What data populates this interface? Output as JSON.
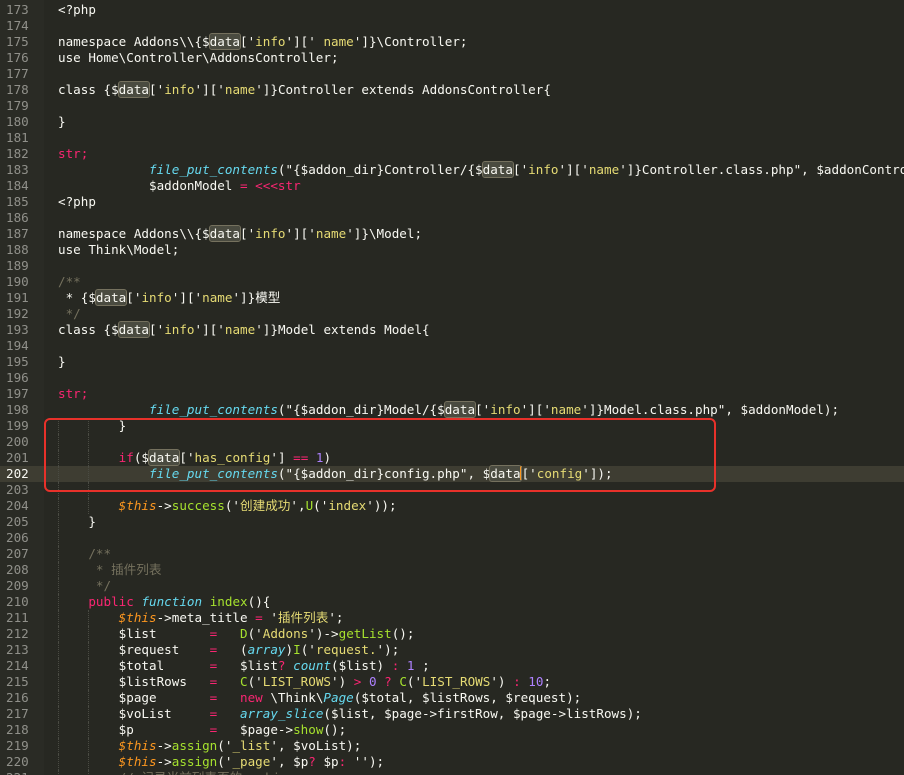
{
  "editor": {
    "current_line": 202,
    "lines": [
      {
        "n": "173",
        "i": 0,
        "t": [
          [
            "<?php",
            ""
          ]
        ]
      },
      {
        "n": "174",
        "i": 0,
        "t": []
      },
      {
        "n": "175",
        "i": 0,
        "t": [
          [
            "namespace Addons\\\\{$",
            ""
          ],
          [
            "data",
            "hl"
          ],
          [
            "['",
            ""
          ],
          [
            "info",
            "s"
          ],
          [
            "'][' ",
            ""
          ],
          [
            "name",
            "s"
          ],
          [
            "']}\\Controller;",
            ""
          ]
        ]
      },
      {
        "n": "176",
        "i": 0,
        "t": [
          [
            "use Home\\Controller\\AddonsController;",
            ""
          ]
        ]
      },
      {
        "n": "177",
        "i": 0,
        "t": []
      },
      {
        "n": "178",
        "i": 0,
        "t": [
          [
            "class {$",
            ""
          ],
          [
            "data",
            "hl"
          ],
          [
            "['",
            ""
          ],
          [
            "info",
            "s"
          ],
          [
            "']['",
            ""
          ],
          [
            "name",
            "s"
          ],
          [
            "']}Controller extends AddonsController{",
            ""
          ]
        ]
      },
      {
        "n": "179",
        "i": 0,
        "t": []
      },
      {
        "n": "180",
        "i": 0,
        "t": [
          [
            "}",
            ""
          ]
        ]
      },
      {
        "n": "181",
        "i": 0,
        "t": []
      },
      {
        "n": "182",
        "i": 0,
        "t": [
          [
            "str;",
            "k"
          ]
        ]
      },
      {
        "n": "183",
        "i": 0,
        "t": [
          [
            "            ",
            ""
          ],
          [
            "file_put_contents",
            "b"
          ],
          [
            "(\"",
            ""
          ],
          [
            "{$addon_dir}Controller/{$",
            ""
          ],
          [
            "data",
            "hl"
          ],
          [
            "['",
            ""
          ],
          [
            "info",
            "s"
          ],
          [
            "']['",
            ""
          ],
          [
            "name",
            "s"
          ],
          [
            "']}Controller.class.php\"",
            ""
          ],
          [
            ", ",
            ""
          ],
          [
            "$addonControl",
            ""
          ]
        ]
      },
      {
        "n": "184",
        "i": 0,
        "t": [
          [
            "            $addonModel ",
            ""
          ],
          [
            "=",
            "k"
          ],
          [
            " <<<str",
            "k"
          ]
        ]
      },
      {
        "n": "185",
        "i": 0,
        "t": [
          [
            "<?php",
            ""
          ]
        ]
      },
      {
        "n": "186",
        "i": 0,
        "t": []
      },
      {
        "n": "187",
        "i": 0,
        "t": [
          [
            "namespace Addons\\\\{$",
            ""
          ],
          [
            "data",
            "hl"
          ],
          [
            "['",
            ""
          ],
          [
            "info",
            "s"
          ],
          [
            "']['",
            ""
          ],
          [
            "name",
            "s"
          ],
          [
            "']}\\Model;",
            ""
          ]
        ]
      },
      {
        "n": "188",
        "i": 0,
        "t": [
          [
            "use Think\\Model;",
            ""
          ]
        ]
      },
      {
        "n": "189",
        "i": 0,
        "t": []
      },
      {
        "n": "190",
        "i": 0,
        "t": [
          [
            "/**",
            "c"
          ]
        ]
      },
      {
        "n": "191",
        "i": 0,
        "t": [
          [
            " * {$",
            ""
          ],
          [
            "data",
            "hl"
          ],
          [
            "['",
            ""
          ],
          [
            "info",
            "s"
          ],
          [
            "']['",
            ""
          ],
          [
            "name",
            "s"
          ],
          [
            "']}模型",
            ""
          ]
        ]
      },
      {
        "n": "192",
        "i": 0,
        "t": [
          [
            " */",
            "c"
          ]
        ]
      },
      {
        "n": "193",
        "i": 0,
        "t": [
          [
            "class {$",
            ""
          ],
          [
            "data",
            "hl"
          ],
          [
            "['",
            ""
          ],
          [
            "info",
            "s"
          ],
          [
            "']['",
            ""
          ],
          [
            "name",
            "s"
          ],
          [
            "']}Model extends Model{",
            ""
          ]
        ]
      },
      {
        "n": "194",
        "i": 0,
        "t": []
      },
      {
        "n": "195",
        "i": 0,
        "t": [
          [
            "}",
            ""
          ]
        ]
      },
      {
        "n": "196",
        "i": 0,
        "t": []
      },
      {
        "n": "197",
        "i": 0,
        "t": [
          [
            "str;",
            "k"
          ]
        ]
      },
      {
        "n": "198",
        "i": 0,
        "t": [
          [
            "            ",
            ""
          ],
          [
            "file_put_contents",
            "b"
          ],
          [
            "(\"{$addon_dir}Model/{$",
            ""
          ],
          [
            "data",
            "hl"
          ],
          [
            "['",
            ""
          ],
          [
            "info",
            "s"
          ],
          [
            "']['",
            ""
          ],
          [
            "name",
            "s"
          ],
          [
            "']}Model.class.php\", $addonModel);",
            ""
          ]
        ]
      },
      {
        "n": "199",
        "i": 2,
        "t": [
          [
            "        }",
            ""
          ]
        ]
      },
      {
        "n": "200",
        "i": 2,
        "t": []
      },
      {
        "n": "201",
        "i": 2,
        "t": [
          [
            "        ",
            ""
          ],
          [
            "if",
            "k"
          ],
          [
            "($",
            ""
          ],
          [
            "data",
            "hl"
          ],
          [
            "['",
            ""
          ],
          [
            "has_config",
            "s"
          ],
          [
            "'] ",
            ""
          ],
          [
            "==",
            "k"
          ],
          [
            " ",
            ""
          ],
          [
            "1",
            "n"
          ],
          [
            ")",
            ""
          ]
        ]
      },
      {
        "n": "202",
        "i": 2,
        "t": [
          [
            "            ",
            ""
          ],
          [
            "file_put_contents",
            "b"
          ],
          [
            "(\"{$addon_dir}config.php\", $",
            ""
          ],
          [
            "data",
            "hl"
          ],
          [
            "|",
            ""
          ],
          [
            "['",
            ""
          ],
          [
            "config",
            "s"
          ],
          [
            "']);",
            ""
          ]
        ]
      },
      {
        "n": "203",
        "i": 2,
        "t": []
      },
      {
        "n": "204",
        "i": 2,
        "t": [
          [
            "        ",
            ""
          ],
          [
            "$this",
            "t"
          ],
          [
            "->",
            ""
          ],
          [
            "success",
            "f"
          ],
          [
            "('",
            ""
          ],
          [
            "创建成功",
            "s"
          ],
          [
            "',",
            ""
          ],
          [
            "U",
            "f"
          ],
          [
            "('",
            ""
          ],
          [
            "index",
            "s"
          ],
          [
            "'));",
            ""
          ]
        ]
      },
      {
        "n": "205",
        "i": 1,
        "t": [
          [
            "    }",
            ""
          ]
        ]
      },
      {
        "n": "206",
        "i": 1,
        "t": []
      },
      {
        "n": "207",
        "i": 1,
        "t": [
          [
            "    /**",
            "c"
          ]
        ]
      },
      {
        "n": "208",
        "i": 1,
        "t": [
          [
            "     * 插件列表",
            "c"
          ]
        ]
      },
      {
        "n": "209",
        "i": 1,
        "t": [
          [
            "     */",
            "c"
          ]
        ]
      },
      {
        "n": "210",
        "i": 1,
        "t": [
          [
            "    ",
            ""
          ],
          [
            "public",
            "k"
          ],
          [
            " ",
            ""
          ],
          [
            "function",
            "b"
          ],
          [
            " ",
            ""
          ],
          [
            "index",
            "f"
          ],
          [
            "(){",
            ""
          ]
        ]
      },
      {
        "n": "211",
        "i": 2,
        "t": [
          [
            "        ",
            ""
          ],
          [
            "$this",
            "t"
          ],
          [
            "->meta_title ",
            ""
          ],
          [
            "=",
            "k"
          ],
          [
            " '",
            ""
          ],
          [
            "插件列表",
            "s"
          ],
          [
            "';",
            ""
          ]
        ]
      },
      {
        "n": "212",
        "i": 2,
        "t": [
          [
            "        $list       ",
            ""
          ],
          [
            "=",
            "k"
          ],
          [
            "   ",
            ""
          ],
          [
            "D",
            "f"
          ],
          [
            "('",
            ""
          ],
          [
            "Addons",
            "s"
          ],
          [
            "')->",
            ""
          ],
          [
            "getList",
            "f"
          ],
          [
            "();",
            ""
          ]
        ]
      },
      {
        "n": "213",
        "i": 2,
        "t": [
          [
            "        $request    ",
            ""
          ],
          [
            "=",
            "k"
          ],
          [
            "   (",
            ""
          ],
          [
            "array",
            "b"
          ],
          [
            ")",
            ""
          ],
          [
            "I",
            "f"
          ],
          [
            "('",
            ""
          ],
          [
            "request.",
            "s"
          ],
          [
            "');",
            ""
          ]
        ]
      },
      {
        "n": "214",
        "i": 2,
        "t": [
          [
            "        $total      ",
            ""
          ],
          [
            "=",
            "k"
          ],
          [
            "   $list",
            ""
          ],
          [
            "?",
            "k"
          ],
          [
            " ",
            ""
          ],
          [
            "count",
            "b"
          ],
          [
            "($list) ",
            ""
          ],
          [
            ":",
            "k"
          ],
          [
            " ",
            ""
          ],
          [
            "1",
            "n"
          ],
          [
            " ;",
            ""
          ]
        ]
      },
      {
        "n": "215",
        "i": 2,
        "t": [
          [
            "        $listRows   ",
            ""
          ],
          [
            "=",
            "k"
          ],
          [
            "   ",
            ""
          ],
          [
            "C",
            "f"
          ],
          [
            "('",
            ""
          ],
          [
            "LIST_ROWS",
            "s"
          ],
          [
            "') ",
            ""
          ],
          [
            ">",
            "k"
          ],
          [
            " ",
            ""
          ],
          [
            "0",
            "n"
          ],
          [
            " ",
            ""
          ],
          [
            "?",
            "k"
          ],
          [
            " ",
            ""
          ],
          [
            "C",
            "f"
          ],
          [
            "('",
            ""
          ],
          [
            "LIST_ROWS",
            "s"
          ],
          [
            "') ",
            ""
          ],
          [
            ":",
            "k"
          ],
          [
            " ",
            ""
          ],
          [
            "10",
            "n"
          ],
          [
            ";",
            ""
          ]
        ]
      },
      {
        "n": "216",
        "i": 2,
        "t": [
          [
            "        $page       ",
            ""
          ],
          [
            "=",
            "k"
          ],
          [
            "   ",
            ""
          ],
          [
            "new",
            "k"
          ],
          [
            " \\Think\\",
            ""
          ],
          [
            "Page",
            "b"
          ],
          [
            "($total, $listRows, $request);",
            ""
          ]
        ]
      },
      {
        "n": "217",
        "i": 2,
        "t": [
          [
            "        $voList     ",
            ""
          ],
          [
            "=",
            "k"
          ],
          [
            "   ",
            ""
          ],
          [
            "array_slice",
            "b"
          ],
          [
            "($list, $page->firstRow, $page->listRows);",
            ""
          ]
        ]
      },
      {
        "n": "218",
        "i": 2,
        "t": [
          [
            "        $p          ",
            ""
          ],
          [
            "=",
            "k"
          ],
          [
            "   $page->",
            ""
          ],
          [
            "show",
            "f"
          ],
          [
            "();",
            ""
          ]
        ]
      },
      {
        "n": "219",
        "i": 2,
        "t": [
          [
            "        ",
            ""
          ],
          [
            "$this",
            "t"
          ],
          [
            "->",
            ""
          ],
          [
            "assign",
            "f"
          ],
          [
            "('",
            ""
          ],
          [
            "_list",
            "s"
          ],
          [
            "', $voList);",
            ""
          ]
        ]
      },
      {
        "n": "220",
        "i": 2,
        "t": [
          [
            "        ",
            ""
          ],
          [
            "$this",
            "t"
          ],
          [
            "->",
            ""
          ],
          [
            "assign",
            "f"
          ],
          [
            "('",
            ""
          ],
          [
            "_page",
            "s"
          ],
          [
            "', $p",
            ""
          ],
          [
            "?",
            "k"
          ],
          [
            " $p",
            ""
          ],
          [
            ":",
            "k"
          ],
          [
            " '');",
            ""
          ]
        ]
      },
      {
        "n": "221",
        "i": 2,
        "t": [
          [
            "        ",
            ""
          ],
          [
            "// 记录当前列表页的cookie",
            "c"
          ]
        ]
      }
    ]
  }
}
